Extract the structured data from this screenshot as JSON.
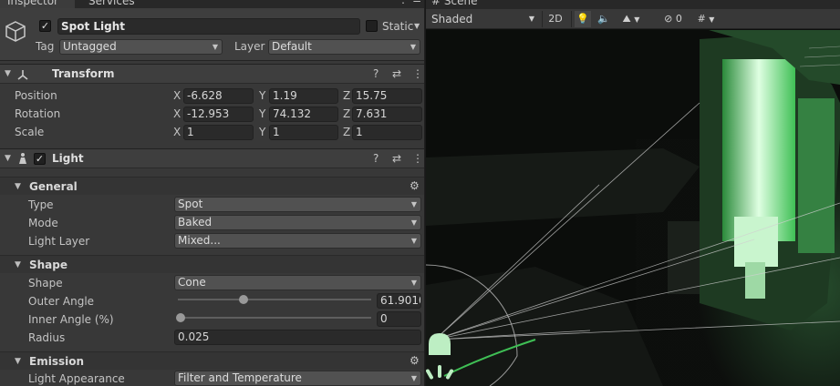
{
  "tabs": {
    "inspector": "Inspector",
    "services": "Services",
    "scene": "Scene"
  },
  "object": {
    "name": "Spot Light",
    "static_label": "Static",
    "tag_label": "Tag",
    "tag_value": "Untagged",
    "layer_label": "Layer",
    "layer_value": "Default"
  },
  "transform": {
    "title": "Transform",
    "rows": [
      {
        "label": "Position",
        "x": "-6.628",
        "y": "1.19",
        "z": "15.75"
      },
      {
        "label": "Rotation",
        "x": "-12.953",
        "y": "74.132",
        "z": "7.631"
      },
      {
        "label": "Scale",
        "x": "1",
        "y": "1",
        "z": "1"
      }
    ]
  },
  "axis_labels": {
    "x": "X",
    "y": "Y",
    "z": "Z"
  },
  "light": {
    "title": "Light",
    "general": {
      "title": "General",
      "type_label": "Type",
      "type_value": "Spot",
      "mode_label": "Mode",
      "mode_value": "Baked",
      "layer_label": "Light Layer",
      "layer_value": "Mixed..."
    },
    "shape": {
      "title": "Shape",
      "shape_label": "Shape",
      "shape_value": "Cone",
      "outer_label": "Outer Angle",
      "outer_value": "61.9010",
      "outer_fraction": 0.34,
      "inner_label": "Inner Angle (%)",
      "inner_value": "0",
      "inner_fraction": 0.0,
      "radius_label": "Radius",
      "radius_value": "0.025"
    },
    "emission": {
      "title": "Emission",
      "appearance_label": "Light Appearance",
      "appearance_value": "Filter and Temperature"
    }
  },
  "scene_toolbar": {
    "draw_mode": "Shaded",
    "mode_2d": "2D",
    "hidden_count": "0",
    "icons": [
      "lightbulb-icon",
      "audio-icon",
      "effects-icon",
      "visibility-icon",
      "grid-icon"
    ]
  },
  "colors": {
    "inspector_bg": "#383838",
    "header_bg": "#3e3e3e",
    "field_bg": "#2a2a2a",
    "dropdown_bg": "#515151",
    "light_glow": "#3fbf55",
    "scene_bg": "#0d0f0d"
  }
}
